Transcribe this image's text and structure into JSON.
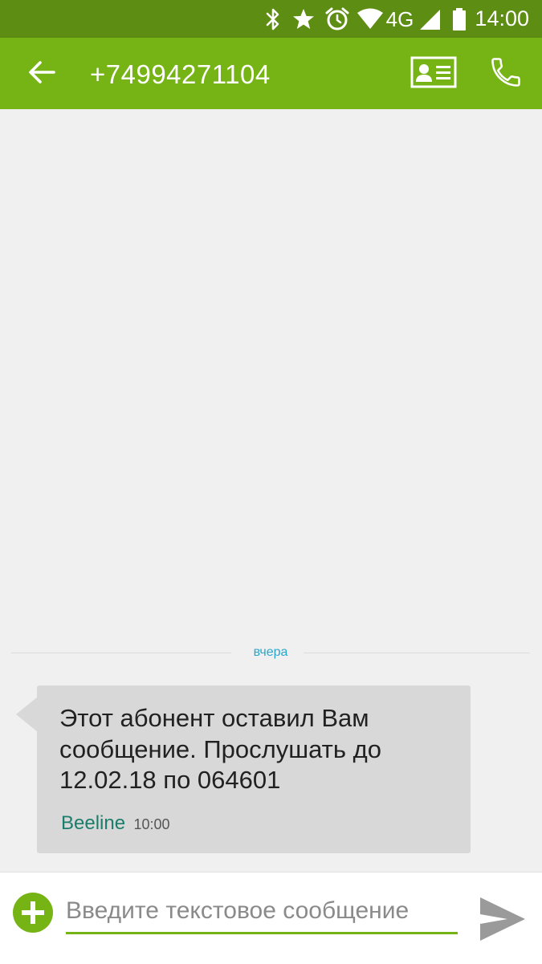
{
  "status_bar": {
    "time": "14:00",
    "network": "4G",
    "icons": [
      "bluetooth-icon",
      "star-icon",
      "alarm-icon",
      "wifi-icon",
      "signal-icon",
      "battery-icon"
    ]
  },
  "app_bar": {
    "title": "+74994271104",
    "icons": {
      "back": "arrow-left-icon",
      "contact": "contact-card-icon",
      "call": "phone-icon"
    }
  },
  "conversation": {
    "date_divider": "вчера",
    "messages": [
      {
        "text": "Этот абонент оставил Вам сообщение. Прослушать до 12.02.18 по 064601",
        "sender": "Beeline",
        "time": "10:00"
      }
    ]
  },
  "composer": {
    "placeholder": "Введите текстовое сообщение",
    "value": "",
    "icons": {
      "attach": "plus-circle-icon",
      "send": "send-icon"
    }
  },
  "colors": {
    "status_bar": "#5d8d12",
    "app_bar": "#76b314",
    "accent": "#76b314",
    "background": "#f0f0f0",
    "bubble": "#d8d8d8",
    "sender": "#1b7d6b",
    "date_label": "#2aa6cc"
  }
}
